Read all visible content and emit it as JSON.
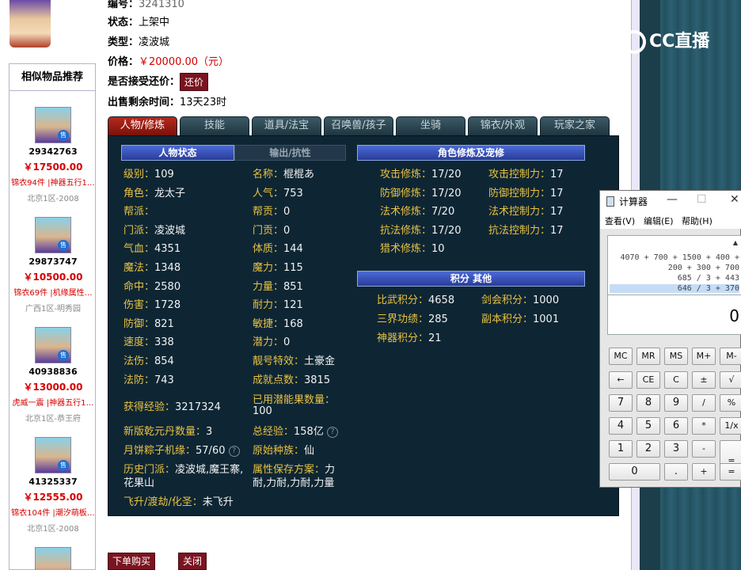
{
  "info": {
    "id_label": "编号：",
    "id_value": "3241310",
    "status_label": "状态：",
    "status_value": "上架中",
    "type_label": "类型：",
    "type_value": "凌波城",
    "price_label": "价格：",
    "price_value": "￥20000.00（元）",
    "bargain_label": "是否接受还价：",
    "bargain_button": "还价",
    "time_label": "出售剩余时间：",
    "time_value": "13天23时"
  },
  "similar": {
    "title": "相似物品推荐",
    "items": [
      {
        "id": "29342763",
        "price": "￥17500.00",
        "desc": "锦衣94件 |神器五行1…",
        "server": "北京1区-2008",
        "sale": "售"
      },
      {
        "id": "29873747",
        "price": "￥10500.00",
        "desc": "锦衣69件 |机缘属性…",
        "server": "广西1区-明秀园",
        "sale": "售"
      },
      {
        "id": "40938836",
        "price": "￥13000.00",
        "desc": "虎威一震 |神器五行1…",
        "server": "北京1区-恭王府",
        "sale": "售"
      },
      {
        "id": "41325337",
        "price": "￥12555.00",
        "desc": "锦衣104件 |潮汐萌板…",
        "server": "北京1区-2008",
        "sale": "售"
      }
    ]
  },
  "tabs": [
    "人物/修炼",
    "技能",
    "道具/法宝",
    "召唤兽/孩子",
    "坐骑",
    "锦衣/外观",
    "玩家之家"
  ],
  "panel": {
    "sub_tab_active": "人物状态",
    "sub_tab_inactive": "输出/抗性",
    "cultivation_header": "角色修炼及宠修",
    "points_header": "积分 其他",
    "left_col": [
      {
        "label": "级别：",
        "value": "109"
      },
      {
        "label": "角色：",
        "value": "龙太子"
      },
      {
        "label": "帮派：",
        "value": ""
      },
      {
        "label": "门派：",
        "value": "凌波城"
      },
      {
        "label": "气血：",
        "value": "4351"
      },
      {
        "label": "魔法：",
        "value": "1348"
      },
      {
        "label": "命中：",
        "value": "2580"
      },
      {
        "label": "伤害：",
        "value": "1728"
      },
      {
        "label": "防御：",
        "value": "821"
      },
      {
        "label": "速度：",
        "value": "338"
      },
      {
        "label": "法伤：",
        "value": "854"
      },
      {
        "label": "法防：",
        "value": "743"
      }
    ],
    "mid_col": [
      {
        "label": "名称：",
        "value": "棍棍あ"
      },
      {
        "label": "人气：",
        "value": "753"
      },
      {
        "label": "帮贡：",
        "value": "0"
      },
      {
        "label": "门贡：",
        "value": "0"
      },
      {
        "label": "体质：",
        "value": "144"
      },
      {
        "label": "魔力：",
        "value": "115"
      },
      {
        "label": "力量：",
        "value": "851"
      },
      {
        "label": "耐力：",
        "value": "121"
      },
      {
        "label": "敏捷：",
        "value": "168"
      },
      {
        "label": "潜力：",
        "value": "0"
      },
      {
        "label": "靓号特效：",
        "value": "土豪金"
      },
      {
        "label": "成就点数：",
        "value": "3815"
      }
    ],
    "exp_label": "获得经验：",
    "exp_value": "3217324",
    "potential_label": "已用潜能果数量：",
    "potential_value": "100",
    "qianyuan_label": "新版乾元丹数量：",
    "qianyuan_value": "3",
    "total_exp_label": "总经验：",
    "total_exp_value": "158亿",
    "zongzi_label": "月饼粽子机缘：",
    "zongzi_value": "57/60",
    "race_label": "原始种族：",
    "race_value": "仙",
    "history_label": "历史门派：",
    "history_value": "凌波城,魔王寨,",
    "history_value2": "花果山",
    "attr_save_label": "属性保存方案：",
    "attr_save_value": "力",
    "attr_save_value2": "耐,力耐,力耐,力量",
    "ascend_label": "飞升/渡劫/化圣：",
    "ascend_value": "未飞升",
    "qmark": "?",
    "cultivation_left": [
      {
        "label": "攻击修炼：",
        "value": "17/20"
      },
      {
        "label": "防御修炼：",
        "value": "17/20"
      },
      {
        "label": "法术修炼：",
        "value": "7/20"
      },
      {
        "label": "抗法修炼：",
        "value": "17/20"
      },
      {
        "label": "猎术修炼：",
        "value": "10"
      }
    ],
    "cultivation_right": [
      {
        "label": "攻击控制力：",
        "value": "17"
      },
      {
        "label": "防御控制力：",
        "value": "17"
      },
      {
        "label": "法术控制力：",
        "value": "17"
      },
      {
        "label": "抗法控制力：",
        "value": "17"
      }
    ],
    "points_left": [
      {
        "label": "比武积分：",
        "value": "4658"
      },
      {
        "label": "三界功绩：",
        "value": "285"
      },
      {
        "label": "神器积分：",
        "value": "21"
      }
    ],
    "points_right": [
      {
        "label": "剑会积分：",
        "value": "1000"
      },
      {
        "label": "副本积分：",
        "value": "1001"
      }
    ]
  },
  "bottom": {
    "buy": "下单购买",
    "close": "关闭"
  },
  "logo_text": "CC直播",
  "calculator": {
    "title": "计算器",
    "menu": [
      "查看(V)",
      "编辑(E)",
      "帮助(H)"
    ],
    "history": [
      "4070 + 700 + 1500 + 400 +",
      "200 + 300 + 700",
      "685 / 3 + 443",
      "646 / 3 + 370"
    ],
    "result": "0",
    "window_buttons": [
      "—",
      "☐",
      "✕"
    ],
    "keys": [
      [
        "MC",
        "MR",
        "MS",
        "M+",
        "M-"
      ],
      [
        "←",
        "CE",
        "C",
        "±",
        "√"
      ],
      [
        "7",
        "8",
        "9",
        "/",
        "%"
      ],
      [
        "4",
        "5",
        "6",
        "*",
        "1/x"
      ],
      [
        "1",
        "2",
        "3",
        "-",
        ""
      ],
      [
        "0",
        "",
        ".",
        "+",
        "="
      ]
    ]
  }
}
